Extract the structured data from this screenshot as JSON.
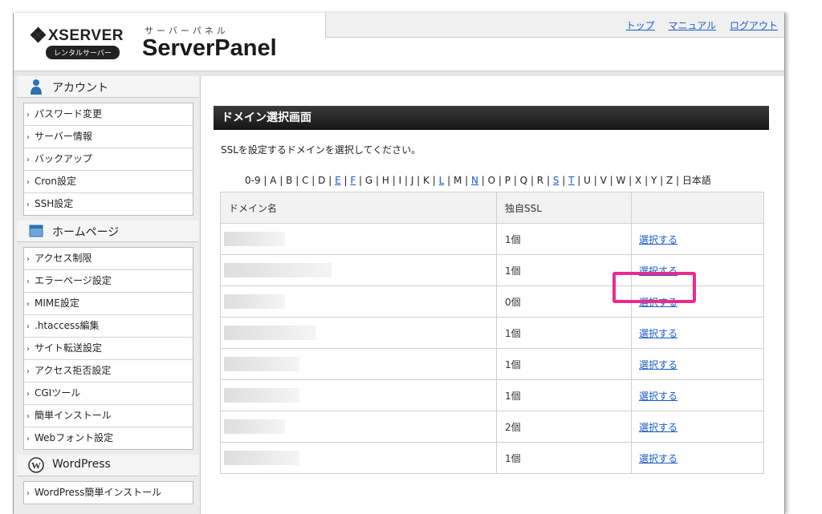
{
  "header": {
    "logo_text": "XSERVER",
    "rental_badge": "レンタルサーバー",
    "panel_subtitle": "サーバーパネル",
    "panel_title": "ServerPanel",
    "links": {
      "top": "トップ",
      "manual": "マニュアル",
      "logout": "ログアウト"
    }
  },
  "sidebar": {
    "account": {
      "title": "アカウント",
      "icon": "user-icon",
      "items": [
        "パスワード変更",
        "サーバー情報",
        "バックアップ",
        "Cron設定",
        "SSH設定"
      ]
    },
    "homepage": {
      "title": "ホームページ",
      "icon": "window-icon",
      "items": [
        "アクセス制限",
        "エラーページ設定",
        "MIME設定",
        ".htaccess編集",
        "サイト転送設定",
        "アクセス拒否設定",
        "CGIツール",
        "簡単インストール",
        "Webフォント設定"
      ]
    },
    "wordpress": {
      "title": "WordPress",
      "icon": "wordpress-icon",
      "items": [
        "WordPress簡単インストール"
      ]
    }
  },
  "main": {
    "title": "ドメイン選択画面",
    "description": "SSLを設定するドメインを選択してください。",
    "alpha_index": [
      {
        "label": "0-9",
        "link": false
      },
      {
        "label": "A",
        "link": false
      },
      {
        "label": "B",
        "link": false
      },
      {
        "label": "C",
        "link": false
      },
      {
        "label": "D",
        "link": false
      },
      {
        "label": "E",
        "link": true
      },
      {
        "label": "F",
        "link": true
      },
      {
        "label": "G",
        "link": false
      },
      {
        "label": "H",
        "link": false
      },
      {
        "label": "I",
        "link": false
      },
      {
        "label": "J",
        "link": false
      },
      {
        "label": "K",
        "link": false
      },
      {
        "label": "L",
        "link": true
      },
      {
        "label": "M",
        "link": false
      },
      {
        "label": "N",
        "link": true
      },
      {
        "label": "O",
        "link": false
      },
      {
        "label": "P",
        "link": false
      },
      {
        "label": "Q",
        "link": false
      },
      {
        "label": "R",
        "link": false
      },
      {
        "label": "S",
        "link": true
      },
      {
        "label": "T",
        "link": true
      },
      {
        "label": "U",
        "link": false
      },
      {
        "label": "V",
        "link": false
      },
      {
        "label": "W",
        "link": false
      },
      {
        "label": "X",
        "link": false
      },
      {
        "label": "Y",
        "link": false
      },
      {
        "label": "Z",
        "link": false
      },
      {
        "label": "日本語",
        "link": false
      }
    ],
    "table": {
      "headers": [
        "ドメイン名",
        "独自SSL",
        ""
      ],
      "rows": [
        {
          "ssl": "1個",
          "action": "選択する"
        },
        {
          "ssl": "1個",
          "action": "選択する"
        },
        {
          "ssl": "0個",
          "action": "選択する"
        },
        {
          "ssl": "1個",
          "action": "選択する"
        },
        {
          "ssl": "1個",
          "action": "選択する"
        },
        {
          "ssl": "1個",
          "action": "選択する"
        },
        {
          "ssl": "2個",
          "action": "選択する"
        },
        {
          "ssl": "1個",
          "action": "選択する"
        }
      ]
    }
  },
  "colors": {
    "link": "#1a5cc8",
    "highlight": "#ec2a8e",
    "title_bar": "#1f1f1f"
  }
}
